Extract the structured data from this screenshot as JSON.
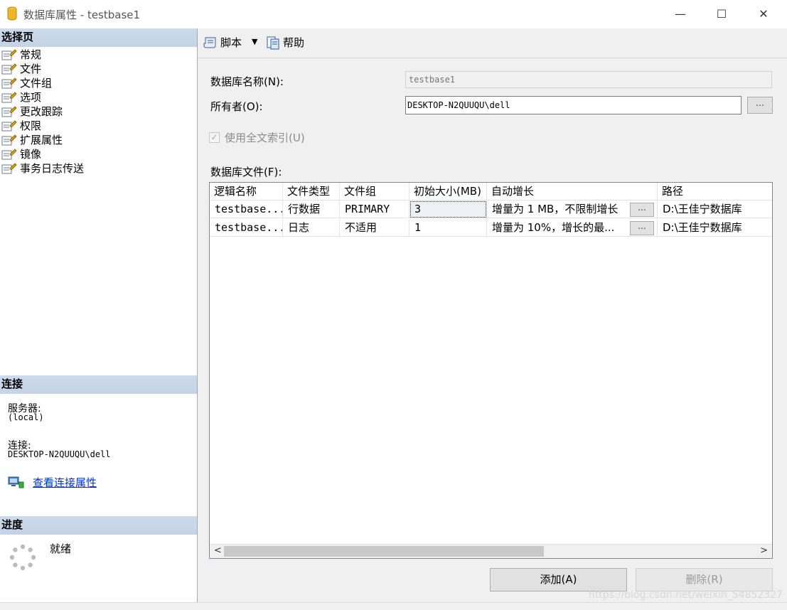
{
  "window": {
    "title": "数据库属性 - testbase1",
    "min_glyph": "—",
    "max_glyph": "☐",
    "close_glyph": "✕"
  },
  "left": {
    "pages_header": "选择页",
    "pages": [
      {
        "label": "常规",
        "selected": false
      },
      {
        "label": "文件",
        "selected": true
      },
      {
        "label": "文件组",
        "selected": false
      },
      {
        "label": "选项",
        "selected": false
      },
      {
        "label": "更改跟踪",
        "selected": false
      },
      {
        "label": "权限",
        "selected": false
      },
      {
        "label": "扩展属性",
        "selected": false
      },
      {
        "label": "镜像",
        "selected": false
      },
      {
        "label": "事务日志传送",
        "selected": false
      }
    ],
    "connection_header": "连接",
    "server_label": "服务器:",
    "server_value": "(local)",
    "connection_label": "连接:",
    "connection_value": "DESKTOP-N2QUUQU\\dell",
    "view_connection_link": "查看连接属性",
    "progress_header": "进度",
    "progress_status": "就绪"
  },
  "toolbar": {
    "script_label": "脚本",
    "dropdown_glyph": "▼",
    "help_label": "帮助"
  },
  "form": {
    "dbname_label": "数据库名称(N):",
    "dbname_value": "testbase1",
    "owner_label": "所有者(O):",
    "owner_value": "DESKTOP-N2QUUQU\\dell",
    "owner_browse": "...",
    "fulltext_label": "使用全文索引(U)",
    "fulltext_checked": true,
    "files_label": "数据库文件(F):"
  },
  "grid": {
    "columns": [
      "逻辑名称",
      "文件类型",
      "文件组",
      "初始大小(MB)",
      "自动增长",
      "路径"
    ],
    "rows": [
      {
        "logical_name": "testbase...",
        "file_type": "行数据",
        "filegroup": "PRIMARY",
        "initial_size": "3",
        "autogrowth": "增量为 1 MB，不限制增长",
        "path": "D:\\王佳宁数据库"
      },
      {
        "logical_name": "testbase...",
        "file_type": "日志",
        "filegroup": "不适用",
        "initial_size": "1",
        "autogrowth": "增量为 10%，增长的最...",
        "path": "D:\\王佳宁数据库"
      }
    ],
    "cell_button": "...",
    "scroll_left": "<",
    "scroll_right": ">"
  },
  "buttons": {
    "add": "添加(A)",
    "remove": "删除(R)"
  },
  "watermark": "https://blog.csdn.net/weixin_54852327"
}
